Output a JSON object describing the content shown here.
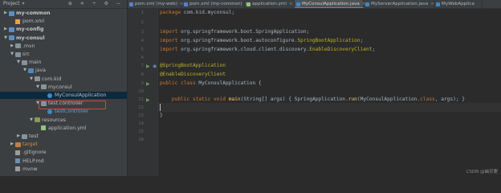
{
  "project_pane": {
    "title": "Project",
    "caret": "▾",
    "tools": "⊕ ≑ ÷ ⚙ −"
  },
  "tree": [
    {
      "label": "my-common",
      "arrow": "▶",
      "icon": "module",
      "bold": true
    },
    {
      "label": "pom.xml",
      "arrow": "",
      "icon": "xml"
    },
    {
      "label": "my-config",
      "arrow": "▶",
      "icon": "module",
      "bold": true
    },
    {
      "label": "my-consul",
      "arrow": "▼",
      "icon": "module",
      "bold": true
    },
    {
      "label": ".mvn",
      "arrow": "▶",
      "icon": "folder"
    },
    {
      "label": "src",
      "arrow": "▼",
      "icon": "folder"
    },
    {
      "label": "main",
      "arrow": "▼",
      "icon": "folder"
    },
    {
      "label": "java",
      "arrow": "▼",
      "icon": "folder-src"
    },
    {
      "label": "com.kid",
      "arrow": "▼",
      "icon": "folder-pkg"
    },
    {
      "label": "myconsul",
      "arrow": "▼",
      "icon": "folder-pkg"
    },
    {
      "label": "MyConsulApplication",
      "arrow": "",
      "icon": "java",
      "selected": true
    },
    {
      "label": "test.controller",
      "arrow": "▼",
      "icon": "folder-pkg"
    },
    {
      "label": "testController",
      "arrow": "",
      "icon": "java"
    },
    {
      "label": "resources",
      "arrow": "▼",
      "icon": "folder-res"
    },
    {
      "label": "application.yml",
      "arrow": "",
      "icon": "yml"
    },
    {
      "label": "test",
      "arrow": "▶",
      "icon": "folder"
    },
    {
      "label": "target",
      "arrow": "▶",
      "icon": "folder-target",
      "orange": true
    },
    {
      "label": ".gitignore",
      "arrow": "",
      "icon": "file"
    },
    {
      "label": "HELP.md",
      "arrow": "",
      "icon": "md"
    },
    {
      "label": "mvnw",
      "arrow": "",
      "icon": "file"
    }
  ],
  "tabs": [
    {
      "label": "pom.xml (my-web)",
      "active": false
    },
    {
      "label": "pom.xml (my-common)",
      "active": false
    },
    {
      "label": "application.yml",
      "active": false
    },
    {
      "label": "MyConsulApplication.java",
      "active": true
    },
    {
      "label": "MyServerApplication.java",
      "active": false
    },
    {
      "label": "MyWebApplica",
      "active": false
    }
  ],
  "tab_close": "×",
  "line_numbers": [
    "1",
    "2",
    "3",
    "4",
    "5",
    "6",
    "7",
    "8",
    "9",
    "10",
    "11",
    "12",
    "13",
    "14",
    "15",
    "16"
  ],
  "code": {
    "l1_kw": "package",
    "l1_rest": " com.kid.myconsul;",
    "l3_kw": "import",
    "l3_rest": " org.springframework.boot.SpringApplication;",
    "l4_kw": "import",
    "l4_rest": " org.springframework.boot.autoconfigure.",
    "l4_ann": "SpringBootApplication",
    "l4_end": ";",
    "l5_kw": "import",
    "l5_rest": " org.springframework.cloud.client.discovery.",
    "l5_ann": "EnableDiscoveryClient",
    "l5_end": ";",
    "l7_ann": "@SpringBootApplication",
    "l8_ann": "@EnableDiscoveryClient",
    "l9_kw": "public class",
    "l9_rest": " MyConsulApplication {",
    "l11_kw": "public static void",
    "l11_mth": " main",
    "l11_rest": "(String[] args) { SpringApplication.",
    "l11_mth2": "run",
    "l11_rest2": "(MyConsulApplication.",
    "l11_kw2": "class",
    "l11_rest3": ", args); }",
    "l13_rest": "}",
    "l12_rest": "}"
  },
  "watermark": "CSDN @幽灵要"
}
